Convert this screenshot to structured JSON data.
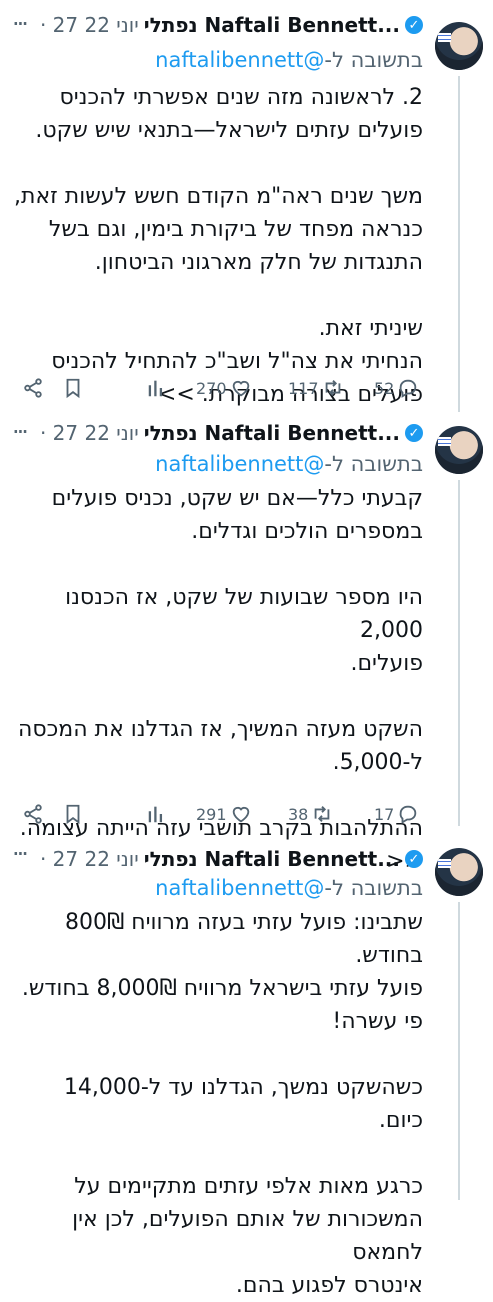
{
  "tweets": [
    {
      "author_name": "נפתלי Naftali Bennett...",
      "verified_mark": "✓",
      "date": "· 27 יוני 22",
      "reply_prefix": "בתשובה ל-",
      "reply_handle": "@naftalibennett",
      "text": "2. לראשונה מזה שנים אפשרתי להכניס\nפועלים עזתים לישראל—בתנאי שיש שקט.\n\nמשך שנים ראה\"מ הקודם חשש לעשות זאת,\nכנראה מפחד של ביקורת בימין, וגם בשל\nהתנגדות של חלק מארגוני הביטחון.\n\nשיניתי זאת.\nהנחיתי את צה\"ל ושב\"כ להתחיל להכניס\nפועלים בצורה מבוקרת. >>",
      "replies": "52",
      "retweets": "117",
      "likes": "270"
    },
    {
      "author_name": "נפתלי Naftali Bennett...",
      "verified_mark": "✓",
      "date": "· 27 יוני 22",
      "reply_prefix": "בתשובה ל-",
      "reply_handle": "@naftalibennett",
      "text": "קבעתי כלל—אם יש שקט, נכניס פועלים\nבמספרים הולכים וגדלים.\n\nהיו מספר שבועות של שקט, אז הכנסנו 2,000\nפועלים.\n\nהשקט מעזה המשיך, אז הגדלנו את המכסה\nל-5,000.\n\nההתלהבות בקרב תושבי עזה הייתה עצומה.\n<<",
      "replies": "17",
      "retweets": "38",
      "likes": "291"
    },
    {
      "author_name": "נפתלי Naftali Bennett...",
      "verified_mark": "✓",
      "date": "· 27 יוני 22",
      "reply_prefix": "בתשובה ל-",
      "reply_handle": "@naftalibennett",
      "text": "שתבינו: פועל עזתי בעזה מרוויח 800₪\nבחודש.\nפועל עזתי בישראל מרוויח 8,000₪ בחודש.\nפי עשרה!\n\nכשהשקט נמשך, הגדלנו עד ל-14,000 כיום.\n\nכרגע מאות אלפי עזתים מתקיימים על\nהמשכורות של אותם הפועלים, לכן אין לחמאס\nאינטרס לפגוע בהם."
    }
  ],
  "icons": [
    "share-icon",
    "bookmark-icon",
    "views-icon",
    "like-icon",
    "retweet-icon",
    "reply-icon",
    "more-icon",
    "verified-icon"
  ],
  "colors": {
    "accent": "#1d9bf0",
    "muted": "#536471",
    "text": "#0f1419",
    "thread_line": "#cfd9de"
  }
}
